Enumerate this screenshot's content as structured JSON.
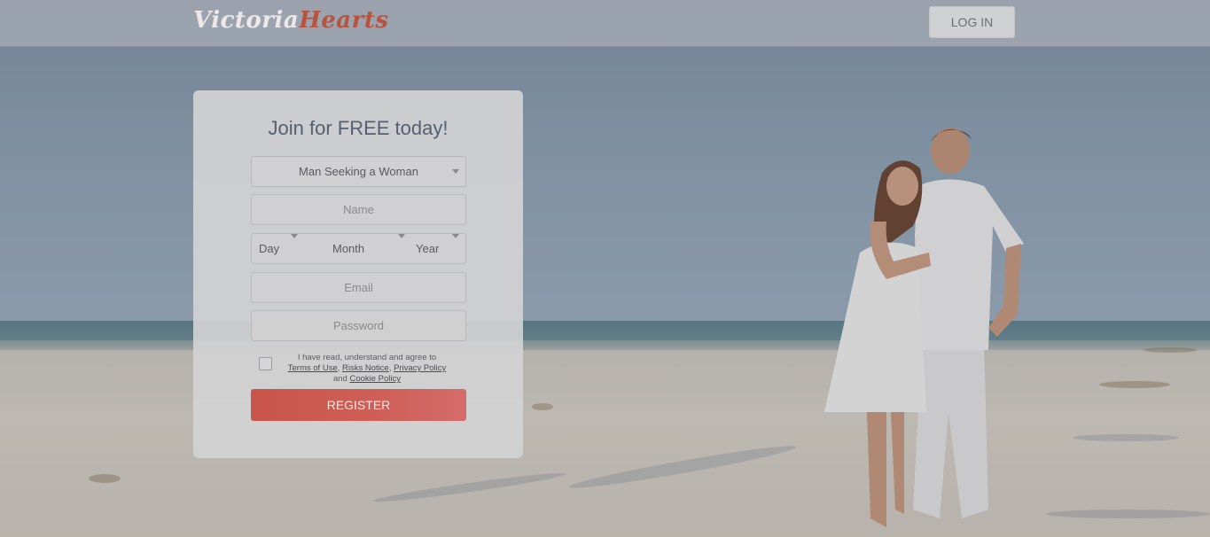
{
  "header": {
    "logo_part1": "Victoria",
    "logo_part2": "Hearts",
    "login_label": "LOG IN"
  },
  "signup": {
    "title": "Join for FREE today!",
    "seeking_value": "Man Seeking a Woman",
    "name_placeholder": "Name",
    "dob": {
      "day_label": "Day",
      "month_label": "Month",
      "year_label": "Year"
    },
    "email_placeholder": "Email",
    "password_placeholder": "Password",
    "agree": {
      "text_before": "I have read, understand and agree to",
      "terms_link": "Terms of Use",
      "sep1": ",",
      "risks_link": "Risks Notice",
      "sep2": ",",
      "privacy_link": "Privacy Policy",
      "and_text": "and",
      "cookie_link": "Cookie Policy"
    },
    "register_label": "REGISTER"
  },
  "colors": {
    "brand_accent": "#c9554a",
    "title_text": "#56606f"
  }
}
